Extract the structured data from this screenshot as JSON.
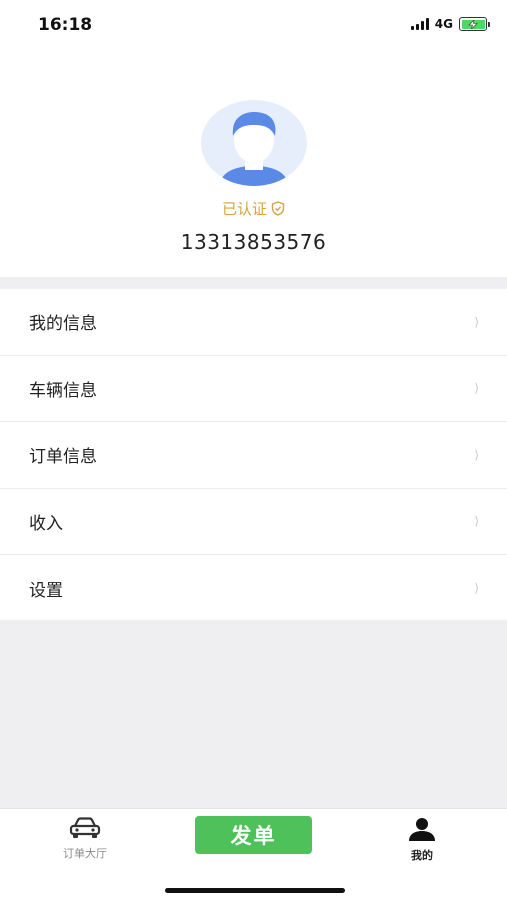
{
  "status_bar": {
    "time": "16:18",
    "network": "4G",
    "battery_level": 1.0,
    "battery_color": "#4cd964"
  },
  "profile": {
    "avatar_icon": "user-avatar-icon",
    "verified_label": "已认证",
    "verified_icon": "shield-check-icon",
    "verified_color": "#d4a442",
    "phone": "13313853576"
  },
  "menu": {
    "items": [
      {
        "label": "我的信息"
      },
      {
        "label": "车辆信息"
      },
      {
        "label": "订单信息"
      },
      {
        "label": "收入"
      },
      {
        "label": "设置"
      }
    ],
    "chevron_icon": "chevron-right-icon"
  },
  "tab_bar": {
    "orders_label": "订单大厅",
    "orders_icon": "car-icon",
    "publish_label": "发单",
    "publish_color": "#4fc15b",
    "mine_label": "我的",
    "mine_icon": "person-icon"
  }
}
